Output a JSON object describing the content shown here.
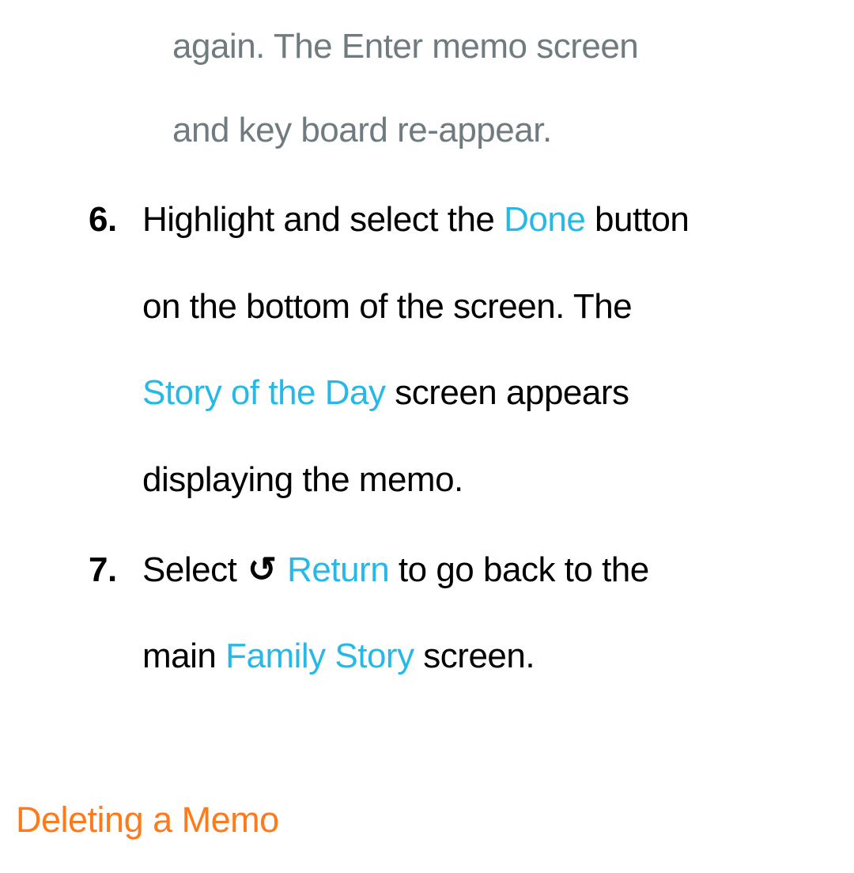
{
  "continuation": {
    "line1": "again. The Enter memo screen",
    "line2": "and key board re-appear."
  },
  "step6": {
    "marker": "6.",
    "seg1": "Highlight and select the ",
    "done": "Done",
    "seg2": " button",
    "seg3": "on the bottom of the screen. The",
    "story": "Story of the Day",
    "seg4": " screen appears",
    "seg5": "displaying the memo."
  },
  "step7": {
    "marker": "7.",
    "seg1": "Select ",
    "return_icon": "↺",
    "return_label": " Return",
    "seg2": " to go back to the",
    "seg3": "main ",
    "family_story": "Family Story",
    "seg4": " screen."
  },
  "heading": "Deleting a Memo"
}
